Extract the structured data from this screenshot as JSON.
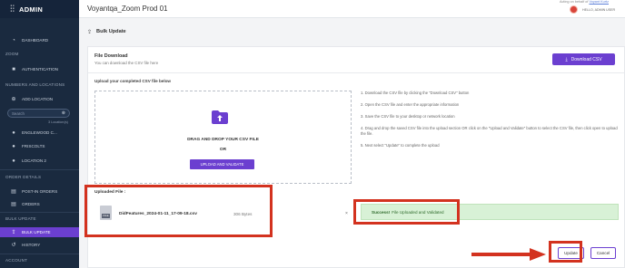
{
  "sidebar": {
    "app_title": "ADMIN",
    "sections": {
      "zoom": "ZOOM",
      "numbers_locations": "NUMBERS AND LOCATIONS",
      "order_details": "ORDER DETAILS",
      "bulk_update": "BULK UPDATE",
      "account": "ACCOUNT"
    },
    "items": {
      "dashboard": "DASHBOARD",
      "authentication": "AUTHENTICATION",
      "add_location": "ADD LOCATION",
      "location_1": "ENGLEWOOD C...",
      "location_2": "FRISCOLTS",
      "location_3": "LOCATION 2",
      "post_in_orders": "POST-IN ORDERS",
      "orders": "ORDERS",
      "bulk_update": "BULK UPDATE",
      "history": "HISTORY"
    },
    "search_placeholder": "Search",
    "location_count": "3 Location(s)"
  },
  "topbar": {
    "environment_title": "Voyantqa_Zoom Prod 01",
    "acting_prefix": "Acting on behalf of",
    "acting_link": "Voyant Kurtz",
    "hello": "HELLO, ADMIN USER"
  },
  "page": {
    "title": "Bulk Update"
  },
  "file_download": {
    "title": "File Download",
    "subtitle": "You can download the CSV file here",
    "button_label": "Download CSV"
  },
  "upload": {
    "title": "Upload your completed CSV file below",
    "dropzone_title": "DRAG AND DROP YOUR CSV FILE",
    "or_label": "OR",
    "button_label": "UPLOAD AND VALIDATE"
  },
  "instructions": [
    "1. Download the CSV file by clicking the \"Download CSV\" button",
    "2. Open the CSV file and enter the appropriate information",
    "3. Save the CSV file to your desktop or network location",
    "4. Drag and drop the saved CSV file into the upload section OR click on the \"Upload and Validate\" button to select the CSV file, then click open to upload the file.",
    "5. Next select \"Update\" to complete the upload"
  ],
  "uploaded_file": {
    "label": "Uploaded File :",
    "icon_tag": "FILE",
    "name": "DidFeatures_2024-01-11_17-09-18.csv",
    "size": "306 Bytes",
    "remove_symbol": "×"
  },
  "status": {
    "bold": "Success!",
    "message": "File Uploaded and Validated"
  },
  "actions": {
    "update_label": "Update",
    "cancel_label": "Cancel"
  },
  "colors": {
    "sidebar_bg": "#1a2a3f",
    "accent": "#6b3fd0",
    "success_bg": "#d8f1d6",
    "annotation_red": "#d3321f"
  }
}
